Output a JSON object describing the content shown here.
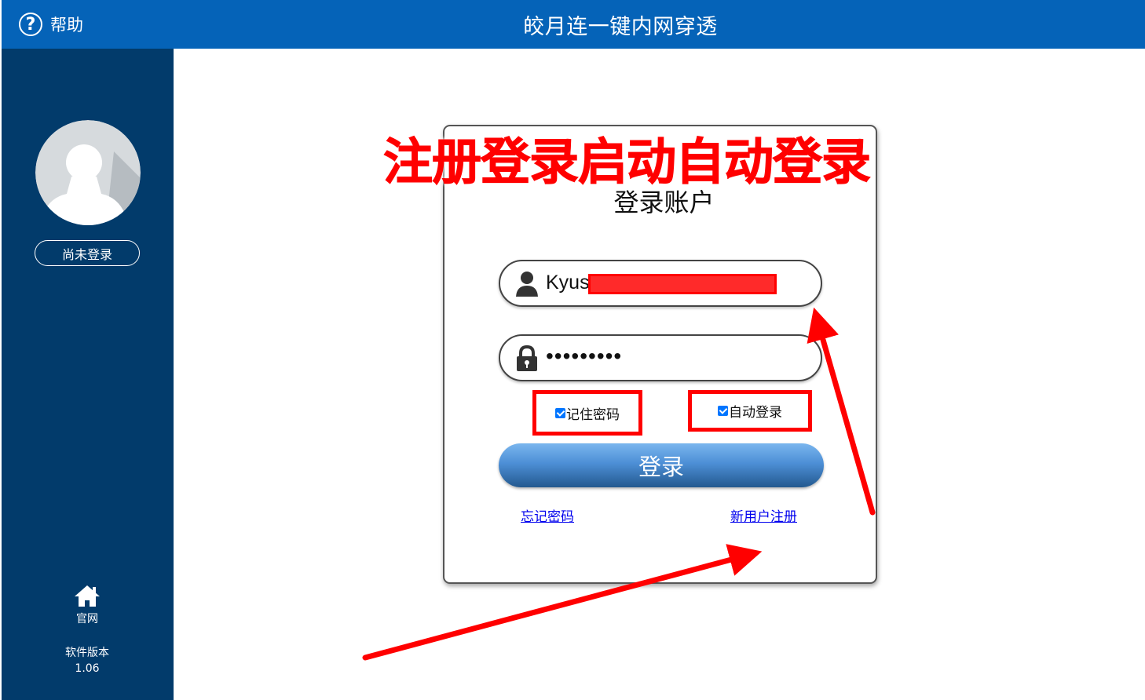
{
  "header": {
    "help_label": "帮助",
    "title": "皎月连一键内网穿透"
  },
  "sidebar": {
    "login_status": "尚未登录",
    "website_label": "官网",
    "version_label": "软件版本",
    "version_number": "1.06"
  },
  "login": {
    "title": "登录账户",
    "username_value": "Kyus",
    "password_value": "•••••••••",
    "remember_password": {
      "label": "记住密码",
      "checked": true
    },
    "auto_login": {
      "label": "自动登录",
      "checked": true
    },
    "submit_label": "登录",
    "forgot_link": "忘记密码",
    "register_link": "新用户注册"
  },
  "annotation": {
    "banner_text": "注册登录启动自动登录",
    "color": "#ff0000"
  },
  "colors": {
    "header": "#0563b8",
    "sidebar": "#023b6b",
    "button": "#4d8fd6"
  }
}
